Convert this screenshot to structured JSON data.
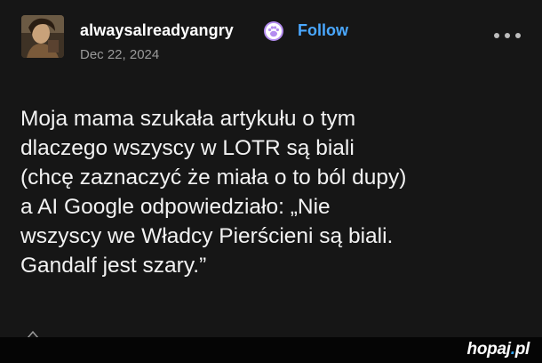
{
  "post": {
    "username": "alwaysalreadyangry",
    "follow_label": "Follow",
    "date": "Dec 22, 2024",
    "body_lines": [
      "Moja mama szukała artykułu o tym",
      "dlaczego wszyscy w LOTR są biali",
      "(chcę zaznaczyć że miała o to ból dupy)",
      "a AI Google odpowiedziało: „Nie",
      "wszyscy we Władcy Pierścieni są biali.",
      "Gandalf jest szary.”"
    ]
  },
  "icons": {
    "avatar": "user-avatar-painting",
    "badge": "paw-badge-icon",
    "more": "more-options-icon"
  },
  "colors": {
    "background": "#161616",
    "text": "#f2f2f2",
    "accent": "#4aa8ff",
    "badge": "#b48cf0",
    "watermark_dot": "#2fa8ff"
  },
  "watermark": {
    "prefix": "hopaj",
    "dot": ".",
    "suffix": "pl"
  }
}
